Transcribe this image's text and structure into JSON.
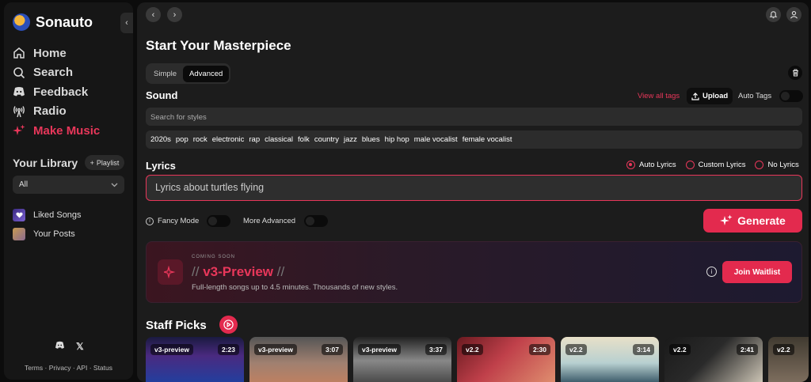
{
  "app": {
    "name": "Sonauto"
  },
  "sidebar": {
    "nav": [
      {
        "label": "Home",
        "icon": "home-icon"
      },
      {
        "label": "Search",
        "icon": "search-icon"
      },
      {
        "label": "Feedback",
        "icon": "discord-icon"
      },
      {
        "label": "Radio",
        "icon": "radio-icon"
      },
      {
        "label": "Make Music",
        "icon": "sparkle-icon",
        "active": true
      }
    ],
    "library_title": "Your Library",
    "playlist_label": "Playlist",
    "filter_value": "All",
    "library_items": [
      {
        "label": "Liked Songs",
        "icon": "heart-icon"
      },
      {
        "label": "Your Posts",
        "icon": "posts-icon"
      }
    ],
    "footer": "Terms · Privacy · API · Status"
  },
  "main": {
    "title": "Start Your Masterpiece",
    "mode_tabs": [
      "Simple",
      "Advanced"
    ],
    "selected_mode": "Advanced",
    "sound_label": "Sound",
    "view_all_tags": "View all tags",
    "upload_label": "Upload",
    "auto_tags_label": "Auto Tags",
    "search_placeholder": "Search for styles",
    "tags": [
      "2020s",
      "pop",
      "rock",
      "electronic",
      "rap",
      "classical",
      "folk",
      "country",
      "jazz",
      "blues",
      "hip hop",
      "male vocalist",
      "female vocalist"
    ],
    "lyrics_label": "Lyrics",
    "lyric_options": [
      "Auto Lyrics",
      "Custom Lyrics",
      "No Lyrics"
    ],
    "lyric_selected": "Auto Lyrics",
    "lyrics_placeholder": "Lyrics about turtles flying",
    "fancy_mode_label": "Fancy Mode",
    "more_advanced_label": "More Advanced",
    "generate_label": "Generate",
    "promo": {
      "eyebrow": "COMING SOON",
      "title": "v3-Preview",
      "slash": "//",
      "subtitle": "Full-length songs up to 4.5 minutes. Thousands of new styles.",
      "button": "Join Waitlist"
    },
    "staff_picks_title": "Staff Picks",
    "cards": [
      {
        "version": "v3-preview",
        "duration": "2:23",
        "bg": "linear-gradient(180deg,#1a1a40 0%,#4a2a80 40%,#2040a0 100%)"
      },
      {
        "version": "v3-preview",
        "duration": "3:07",
        "bg": "linear-gradient(180deg,#555 0%,#a08070 55%,#c08060 100%)"
      },
      {
        "version": "v3-preview",
        "duration": "3:37",
        "bg": "linear-gradient(180deg,#222 0%,#888 50%,#444 100%)"
      },
      {
        "version": "v2.2",
        "duration": "2:30",
        "bg": "linear-gradient(135deg,#6a1a20 0%,#c0404a 45%,#e09070 100%)"
      },
      {
        "version": "v2.2",
        "duration": "3:14",
        "bg": "linear-gradient(180deg,#e8e0c8 0%,#b8d0d0 55%,#305060 100%)"
      },
      {
        "version": "v2.2",
        "duration": "2:41",
        "bg": "linear-gradient(135deg,#1a1a1a 0%,#2a2a2a 45%,#d0c8b8 100%)"
      },
      {
        "version": "v2.2",
        "duration": "",
        "bg": "linear-gradient(180deg,#403a30 0%,#807060 100%)"
      }
    ]
  }
}
